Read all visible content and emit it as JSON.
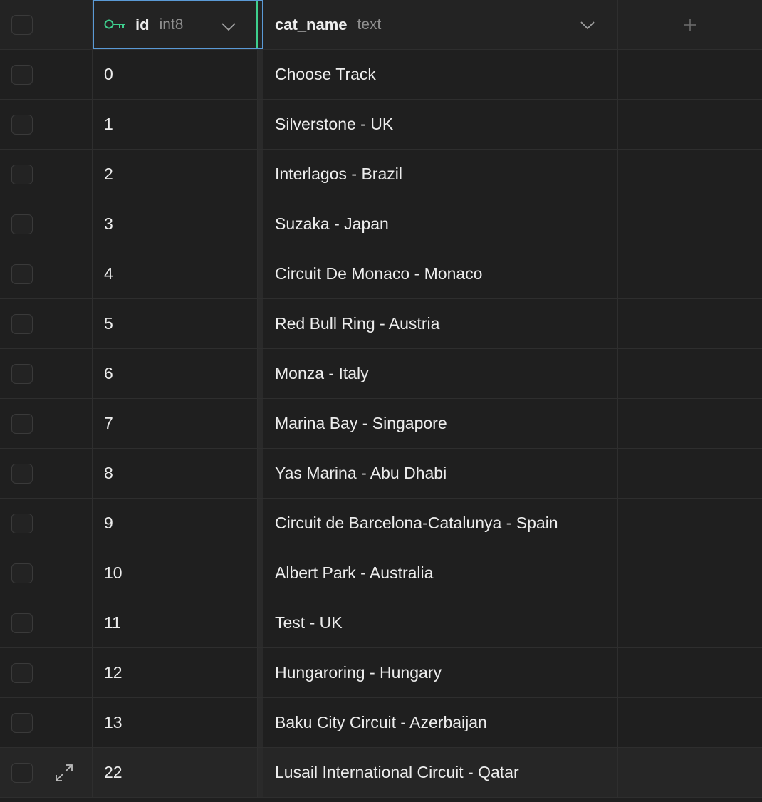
{
  "columns": [
    {
      "name": "id",
      "type": "int8",
      "primary_key": true
    },
    {
      "name": "cat_name",
      "type": "text"
    }
  ],
  "rows": [
    {
      "id": "0",
      "cat_name": "Choose Track"
    },
    {
      "id": "1",
      "cat_name": "Silverstone - UK"
    },
    {
      "id": "2",
      "cat_name": "Interlagos - Brazil"
    },
    {
      "id": "3",
      "cat_name": "Suzaka - Japan"
    },
    {
      "id": "4",
      "cat_name": "Circuit De Monaco - Monaco"
    },
    {
      "id": "5",
      "cat_name": "Red Bull Ring - Austria"
    },
    {
      "id": "6",
      "cat_name": "Monza - Italy"
    },
    {
      "id": "7",
      "cat_name": "Marina Bay - Singapore"
    },
    {
      "id": "8",
      "cat_name": "Yas Marina - Abu Dhabi"
    },
    {
      "id": "9",
      "cat_name": "Circuit de Barcelona-Catalunya - Spain"
    },
    {
      "id": "10",
      "cat_name": "Albert Park - Australia"
    },
    {
      "id": "11",
      "cat_name": "Test - UK"
    },
    {
      "id": "12",
      "cat_name": "Hungaroring - Hungary"
    },
    {
      "id": "13",
      "cat_name": "Baku City Circuit - Azerbaijan"
    },
    {
      "id": "22",
      "cat_name": "Lusail International Circuit - Qatar"
    }
  ],
  "icons": {
    "primary_key": "key-icon",
    "column_menu": "chevron-down-icon",
    "add_column": "plus-icon",
    "expand_row": "expand-icon"
  },
  "colors": {
    "accent_green": "#3ecf8e",
    "selection_blue": "#5a9ad6",
    "background": "#1f1f1f"
  }
}
